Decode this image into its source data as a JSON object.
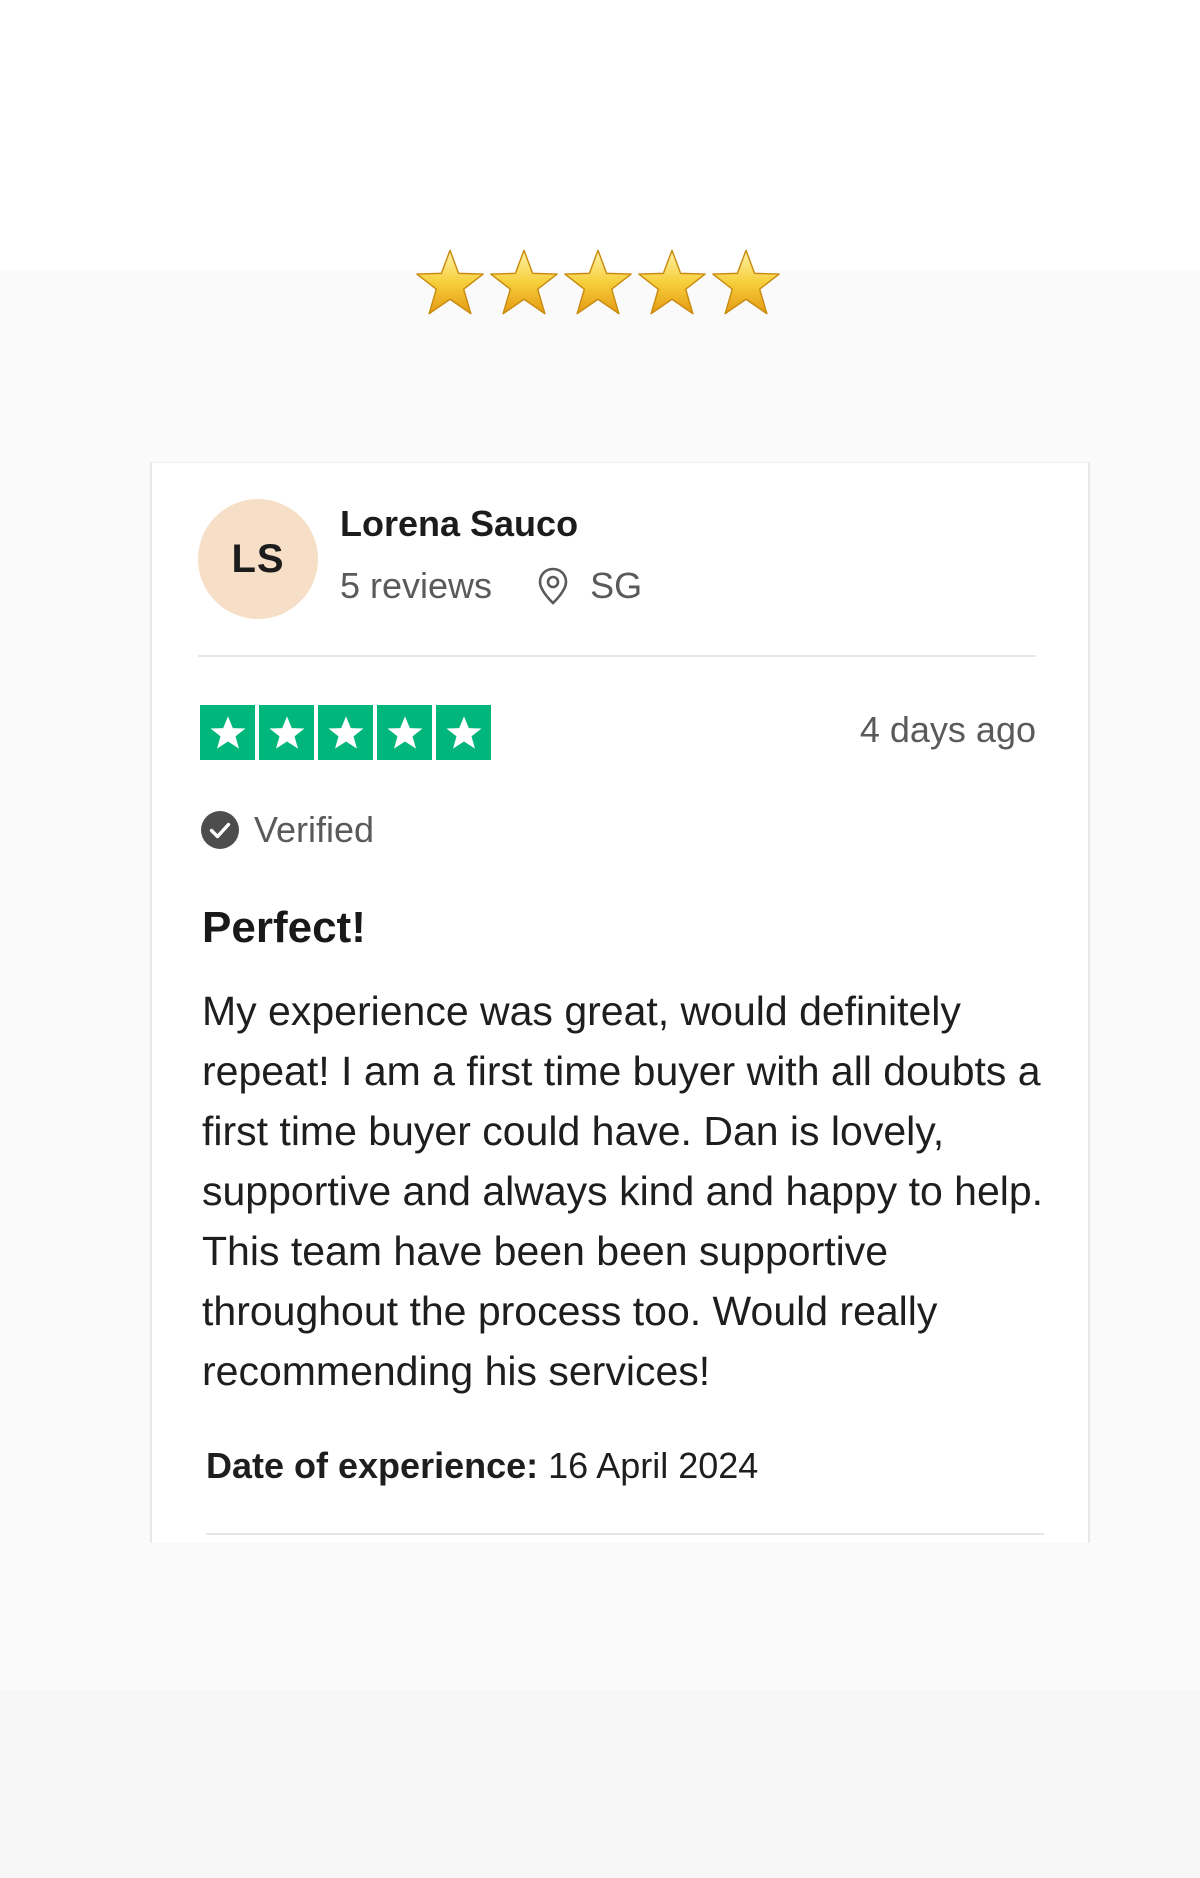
{
  "header": {
    "emoji_star_count": 5,
    "emoji_star_color": "#f5c12e"
  },
  "review": {
    "avatar_initials": "LS",
    "avatar_color": "#f6dfc6",
    "reviewer_name": "Lorena Sauco",
    "review_count": "5 reviews",
    "location_icon": "location-pin-icon",
    "location": "SG",
    "rating": 5,
    "rating_max": 5,
    "rating_color": "#00b67a",
    "date_posted": "4 days ago",
    "verified_icon": "check-circle-icon",
    "verified_label": "Verified",
    "title": "Perfect!",
    "body": "My experience was great, would definitely repeat! I am a first time buyer with all doubts a first time buyer could have. Dan is lovely, supportive and always kind and happy to help. This team have been been supportive throughout the process too. Would really recommending his services!",
    "experience_label": "Date of experience:",
    "experience_date": "16 April 2024"
  }
}
